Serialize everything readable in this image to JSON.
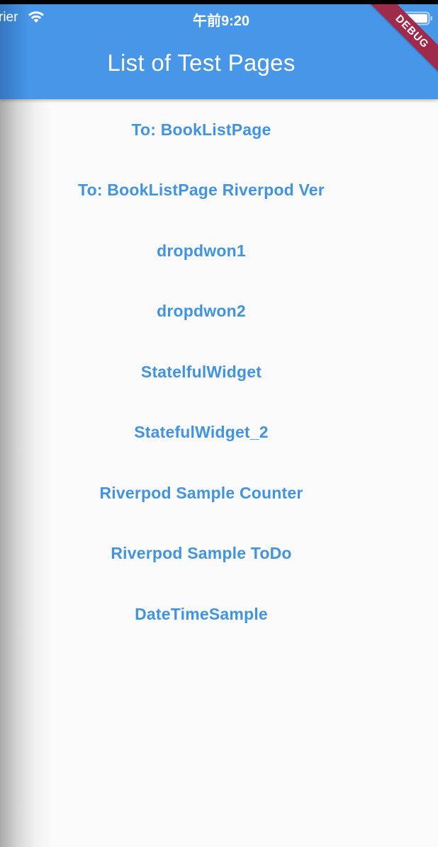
{
  "status_bar": {
    "carrier": "rier",
    "time": "午前9:20"
  },
  "app_bar": {
    "title": "List of Test Pages"
  },
  "debug_banner": "DEBUG",
  "list": {
    "items": [
      {
        "label": "To: BookListPage"
      },
      {
        "label": "To: BookListPage Riverpod Ver"
      },
      {
        "label": "dropdwon1"
      },
      {
        "label": "dropdwon2"
      },
      {
        "label": "StatelfulWidget"
      },
      {
        "label": "StatefulWidget_2"
      },
      {
        "label": "Riverpod Sample Counter"
      },
      {
        "label": "Riverpod Sample ToDo"
      },
      {
        "label": "DateTimeSample"
      }
    ]
  },
  "colors": {
    "app_bar": "#4796e8",
    "link_text": "#4194df",
    "background": "#fafafa",
    "debug_banner": "#9e2b4c"
  },
  "icons": [
    "wifi-icon",
    "battery-icon"
  ]
}
